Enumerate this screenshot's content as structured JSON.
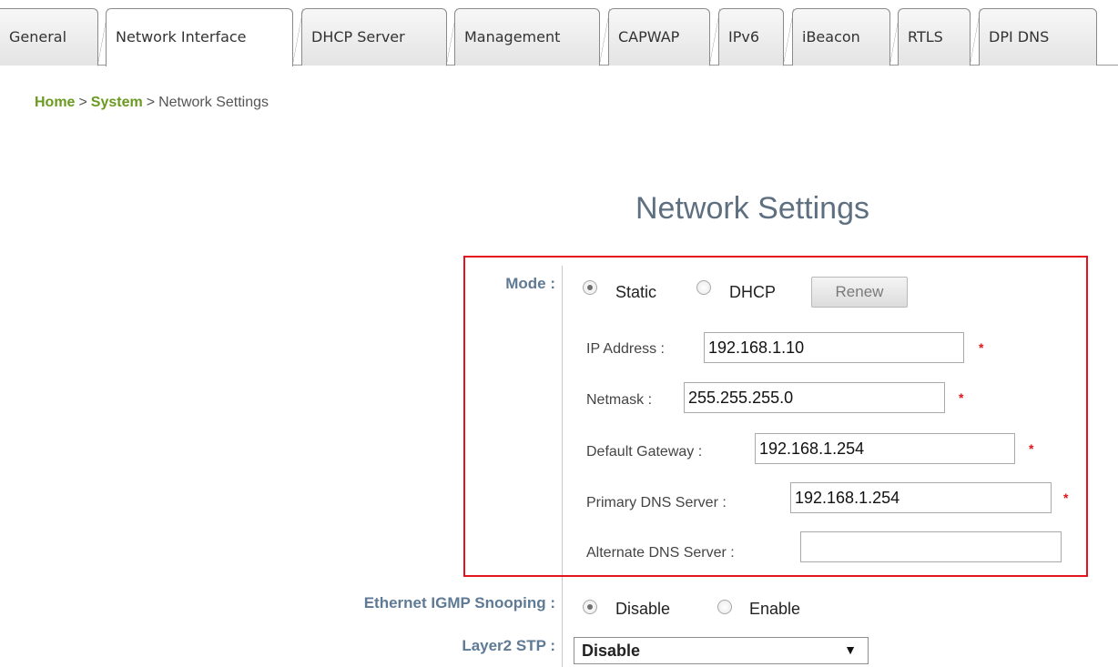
{
  "tabs": [
    {
      "label": "General"
    },
    {
      "label": "Network Interface"
    },
    {
      "label": "DHCP Server"
    },
    {
      "label": "Management"
    },
    {
      "label": "CAPWAP"
    },
    {
      "label": "IPv6"
    },
    {
      "label": "iBeacon"
    },
    {
      "label": "RTLS"
    },
    {
      "label": "DPI DNS"
    }
  ],
  "active_tab": "Network Interface",
  "breadcrumb": {
    "home": "Home",
    "system": "System",
    "current": "Network Settings",
    "separator": ">"
  },
  "title": "Network Settings",
  "mode": {
    "label": "Mode :",
    "options": [
      "Static",
      "DHCP"
    ],
    "selected": "Static",
    "renew_button": "Renew"
  },
  "fields": {
    "ip_address": {
      "label": "IP Address :",
      "value": "192.168.1.10",
      "required": "*"
    },
    "netmask": {
      "label": "Netmask :",
      "value": "255.255.255.0",
      "required": "*"
    },
    "default_gateway": {
      "label": "Default Gateway :",
      "value": "192.168.1.254",
      "required": "*"
    },
    "primary_dns": {
      "label": "Primary DNS Server :",
      "value": "192.168.1.254",
      "required": "*"
    },
    "alternate_dns": {
      "label": "Alternate DNS Server :",
      "value": ""
    }
  },
  "igmp": {
    "label": "Ethernet IGMP Snooping :",
    "options": [
      "Disable",
      "Enable"
    ],
    "selected": "Disable"
  },
  "stp": {
    "label": "Layer2 STP :",
    "value": "Disable"
  },
  "colors": {
    "breadcrumb_link": "#6a9a1f",
    "label": "#5e7a94",
    "highlight_box": "#e3141d"
  }
}
